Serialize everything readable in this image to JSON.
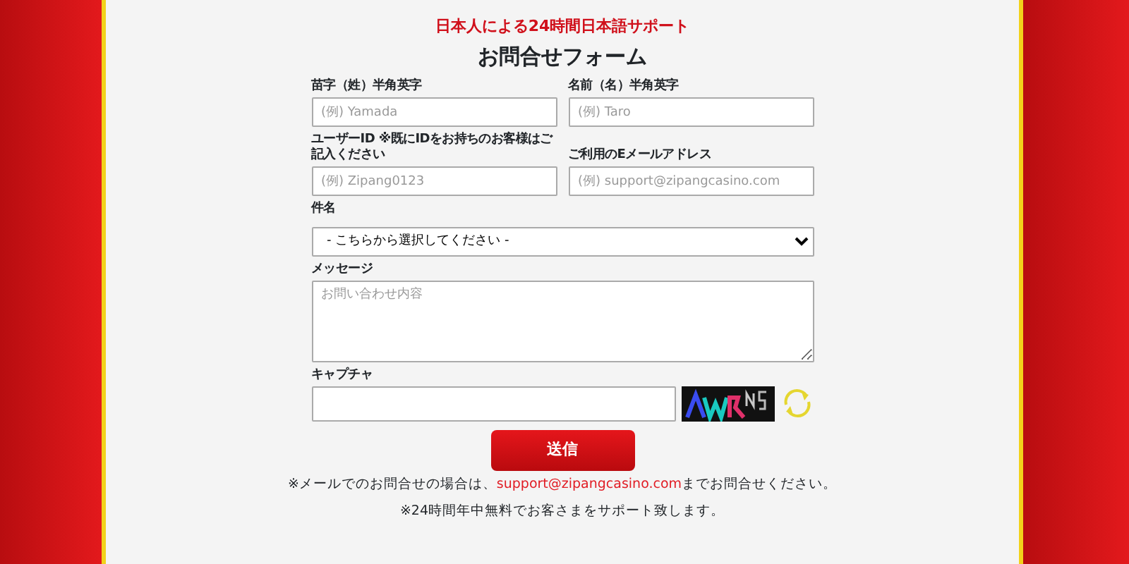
{
  "tagline": "日本人による24時間日本語サポート",
  "title": "お問合せフォーム",
  "fields": [
    {
      "kind": "input",
      "label": "苗字（姓）半角英字",
      "placeholder": "(例) Yamada"
    },
    {
      "kind": "input",
      "label": "名前（名）半角英字",
      "placeholder": "(例) Taro"
    },
    {
      "kind": "input",
      "label": "ユーザーID ※既にIDをお持ちのお客様はご記入ください",
      "placeholder": "(例) Zipang0123"
    },
    {
      "kind": "input",
      "label": "ご利用のEメールアドレス",
      "placeholder": "(例) support@zipangcasino.com"
    },
    {
      "kind": "select",
      "label": "件名",
      "value": "- こちらから選択してください -"
    },
    {
      "kind": "textarea",
      "label": "メッセージ",
      "placeholder": "お問い合わせ内容"
    },
    {
      "kind": "captcha",
      "label": "キャプチャ"
    }
  ],
  "submit": "送信",
  "note": {
    "before": "※メールでのお問合せの場合は、",
    "link": "support@zipangcasino.com",
    "after": "までお問合せください。"
  },
  "footer": "※24時間年中無料でお客さまをサポート致します。"
}
